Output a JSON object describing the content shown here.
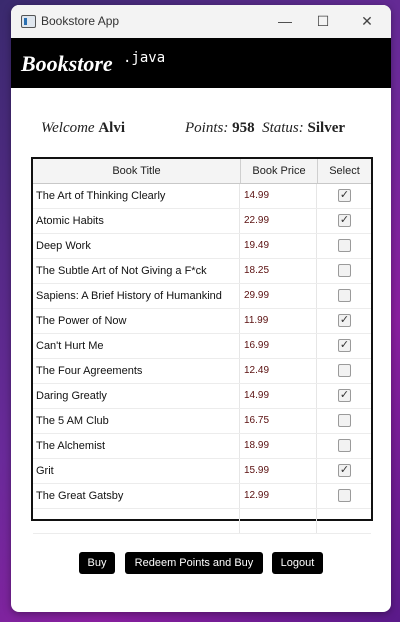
{
  "window": {
    "title": "Bookstore App"
  },
  "header": {
    "brand": "Bookstore",
    "suffix": ".java"
  },
  "info": {
    "welcome_label": "Welcome",
    "user_name": "Alvi",
    "points_label": "Points:",
    "points_value": "958",
    "status_label": "Status:",
    "status_value": "Silver"
  },
  "table": {
    "columns": [
      "Book Title",
      "Book Price",
      "Select"
    ],
    "rows": [
      {
        "title": "The Art of Thinking Clearly",
        "price": "14.99",
        "selected": true
      },
      {
        "title": "Atomic Habits",
        "price": "22.99",
        "selected": true
      },
      {
        "title": "Deep Work",
        "price": "19.49",
        "selected": false
      },
      {
        "title": "The Subtle Art of Not Giving a F*ck",
        "price": "18.25",
        "selected": false
      },
      {
        "title": "Sapiens: A Brief History of Humankind",
        "price": "29.99",
        "selected": false
      },
      {
        "title": "The Power of Now",
        "price": "11.99",
        "selected": true
      },
      {
        "title": "Can't Hurt Me",
        "price": "16.99",
        "selected": true
      },
      {
        "title": "The Four Agreements",
        "price": "12.49",
        "selected": false
      },
      {
        "title": "Daring Greatly",
        "price": "14.99",
        "selected": true
      },
      {
        "title": "The 5 AM Club",
        "price": "16.75",
        "selected": false
      },
      {
        "title": "The Alchemist",
        "price": "18.99",
        "selected": false
      },
      {
        "title": "Grit",
        "price": "15.99",
        "selected": true
      },
      {
        "title": "The Great Gatsby",
        "price": "12.99",
        "selected": false
      }
    ]
  },
  "buttons": {
    "buy": "Buy",
    "redeem": "Redeem Points and Buy",
    "logout": "Logout"
  }
}
